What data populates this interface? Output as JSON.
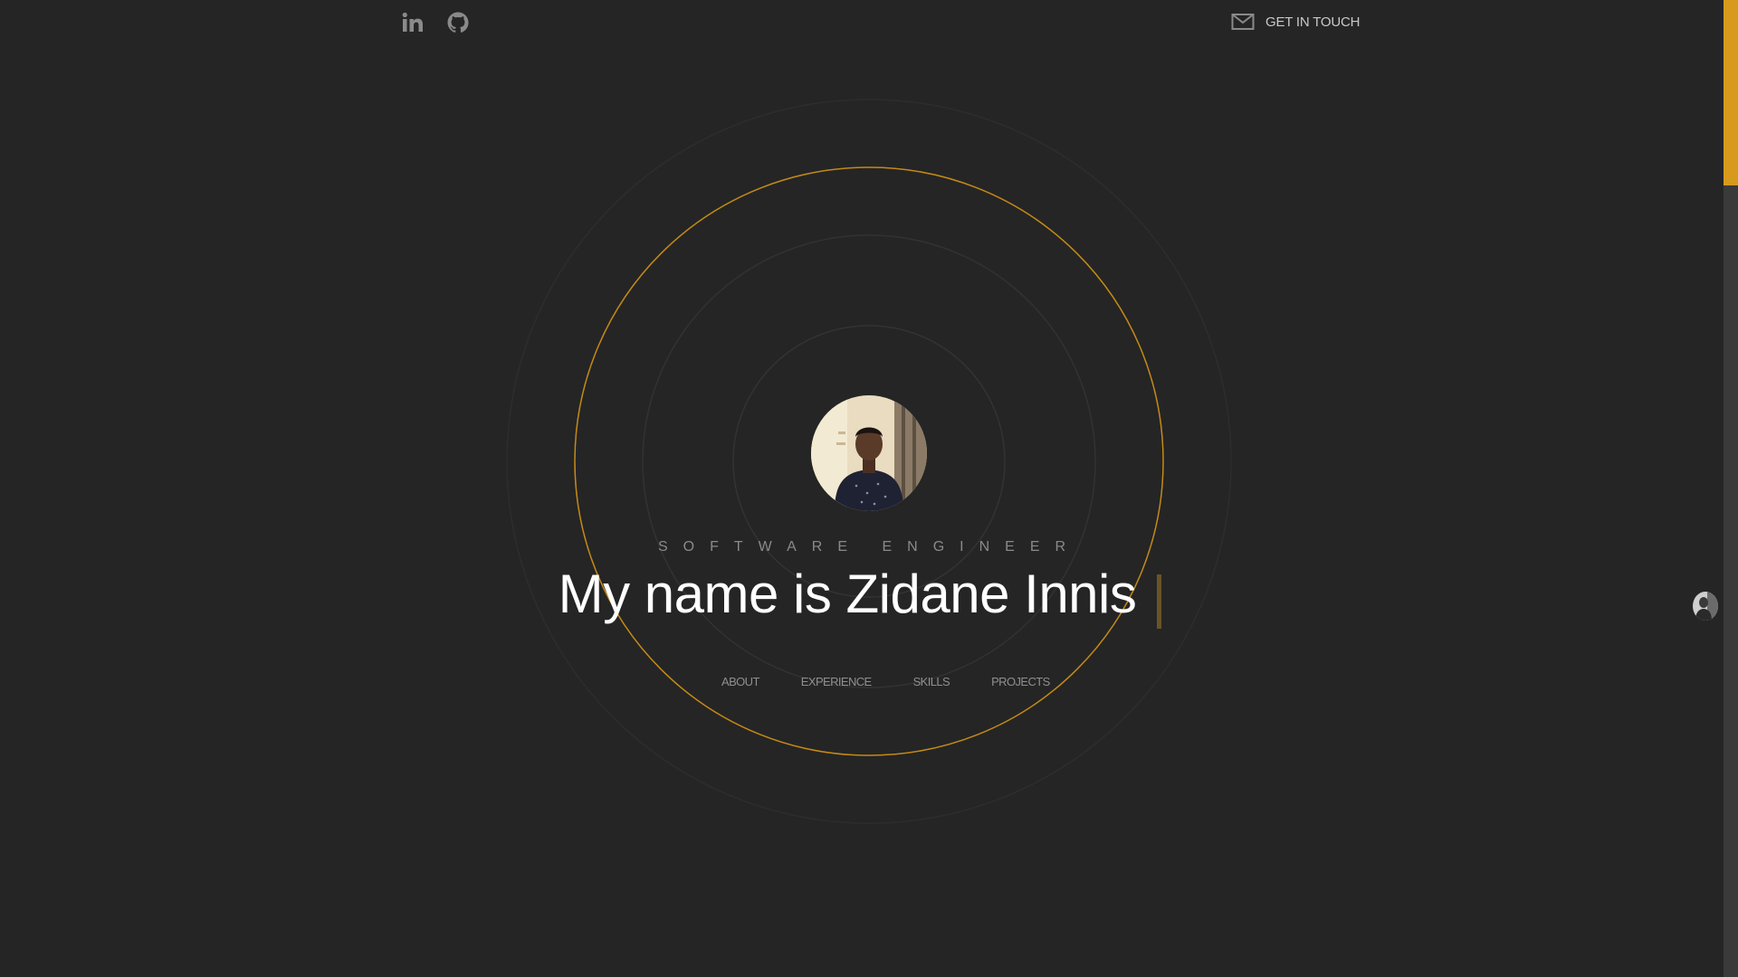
{
  "header": {
    "social": [
      {
        "name": "linkedin",
        "icon": "linkedin-icon"
      },
      {
        "name": "github",
        "icon": "github-icon"
      }
    ],
    "contact_label": "GET IN TOUCH",
    "contact_icon": "mail-icon"
  },
  "hero": {
    "subtitle": "SOFTWARE ENGINEER",
    "headline": "My name is Zidane Innis",
    "avatar": "profile-photo"
  },
  "nav": {
    "items": [
      "ABOUT",
      "EXPERIENCE",
      "SKILLS",
      "PROJECTS"
    ]
  },
  "colors": {
    "background": "#252525",
    "accent": "#d89a1c",
    "ring": "#333333",
    "text_muted": "#8f8f8f"
  }
}
